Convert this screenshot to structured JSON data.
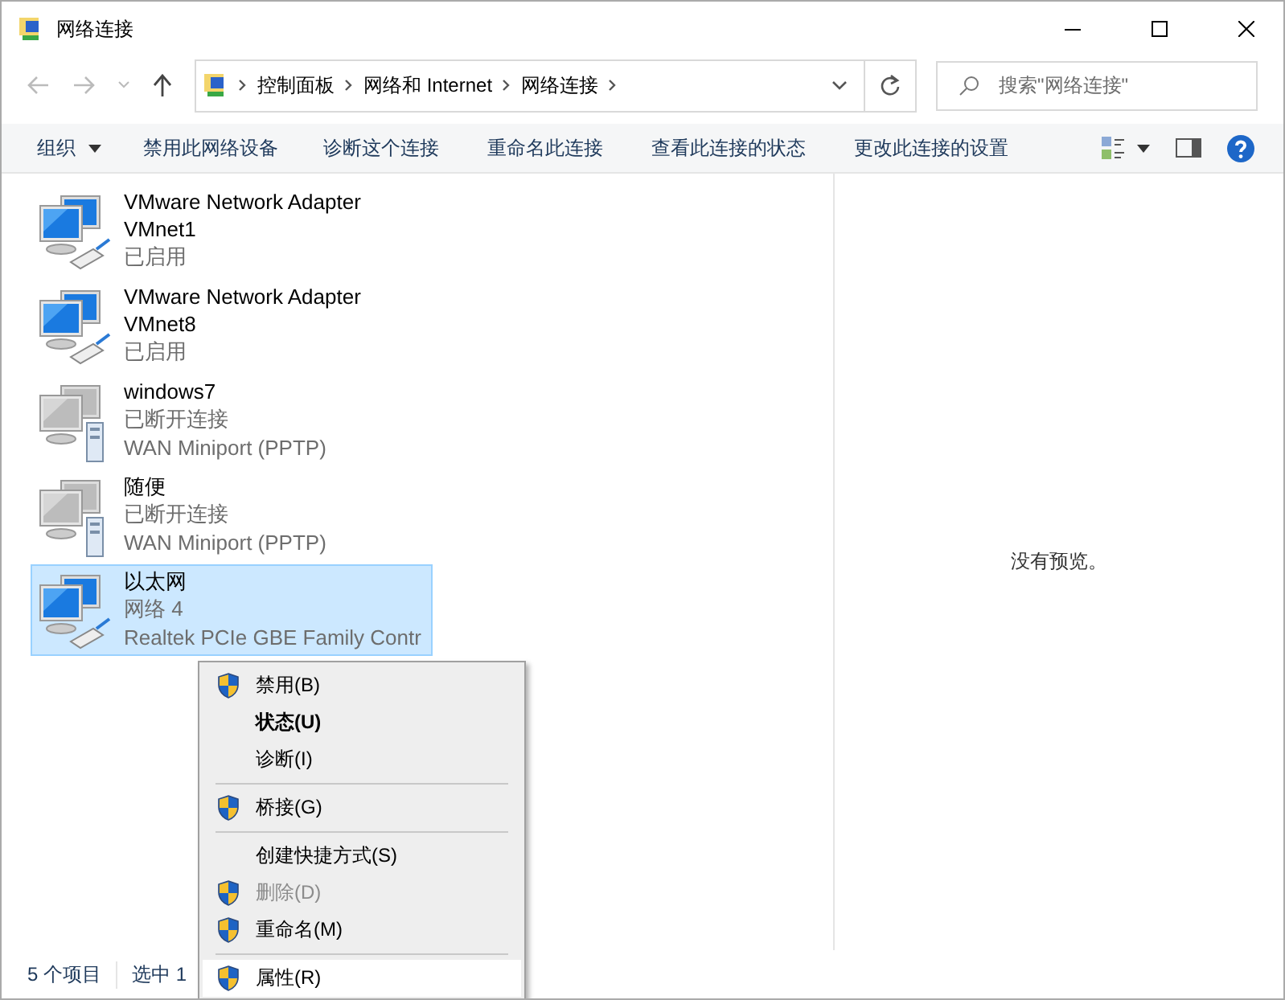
{
  "window": {
    "title": "网络连接"
  },
  "address": {
    "crumbs": [
      "控制面板",
      "网络和 Internet",
      "网络连接"
    ]
  },
  "search": {
    "placeholder": "搜索\"网络连接\""
  },
  "toolbar": {
    "organize": "组织",
    "buttons": [
      "禁用此网络设备",
      "诊断这个连接",
      "重命名此连接",
      "查看此连接的状态",
      "更改此连接的设置"
    ]
  },
  "connections": [
    {
      "kind": "ethernet",
      "name": "VMware Network Adapter VMnet1",
      "status": "已启用",
      "selected": false
    },
    {
      "kind": "ethernet",
      "name": "VMware Network Adapter VMnet8",
      "status": "已启用",
      "selected": false
    },
    {
      "kind": "wan",
      "name": "windows7",
      "status": "已断开连接",
      "device": "WAN Miniport (PPTP)",
      "selected": false
    },
    {
      "kind": "wan",
      "name": "随便",
      "status": "已断开连接",
      "device": "WAN Miniport (PPTP)",
      "selected": false
    },
    {
      "kind": "ethernet",
      "name": "以太网",
      "status": "网络 4",
      "device": "Realtek PCIe GBE Family Contr",
      "selected": true
    }
  ],
  "preview": {
    "text": "没有预览。"
  },
  "status_bar": [
    "5 个项目",
    "选中 1"
  ],
  "context_menu": [
    {
      "kind": "item",
      "label": "禁用(B)",
      "shield": true,
      "default": false,
      "disabled": false,
      "selected": false
    },
    {
      "kind": "item",
      "label": "状态(U)",
      "shield": false,
      "default": true,
      "disabled": false,
      "selected": false
    },
    {
      "kind": "item",
      "label": "诊断(I)",
      "shield": false,
      "default": false,
      "disabled": false,
      "selected": false
    },
    {
      "kind": "separator"
    },
    {
      "kind": "item",
      "label": "桥接(G)",
      "shield": true,
      "default": false,
      "disabled": false,
      "selected": false
    },
    {
      "kind": "separator"
    },
    {
      "kind": "item",
      "label": "创建快捷方式(S)",
      "shield": false,
      "default": false,
      "disabled": false,
      "selected": false
    },
    {
      "kind": "item",
      "label": "删除(D)",
      "shield": true,
      "default": false,
      "disabled": true,
      "selected": false
    },
    {
      "kind": "item",
      "label": "重命名(M)",
      "shield": true,
      "default": false,
      "disabled": false,
      "selected": false
    },
    {
      "kind": "separator"
    },
    {
      "kind": "item",
      "label": "属性(R)",
      "shield": true,
      "default": false,
      "disabled": false,
      "selected": true
    }
  ]
}
